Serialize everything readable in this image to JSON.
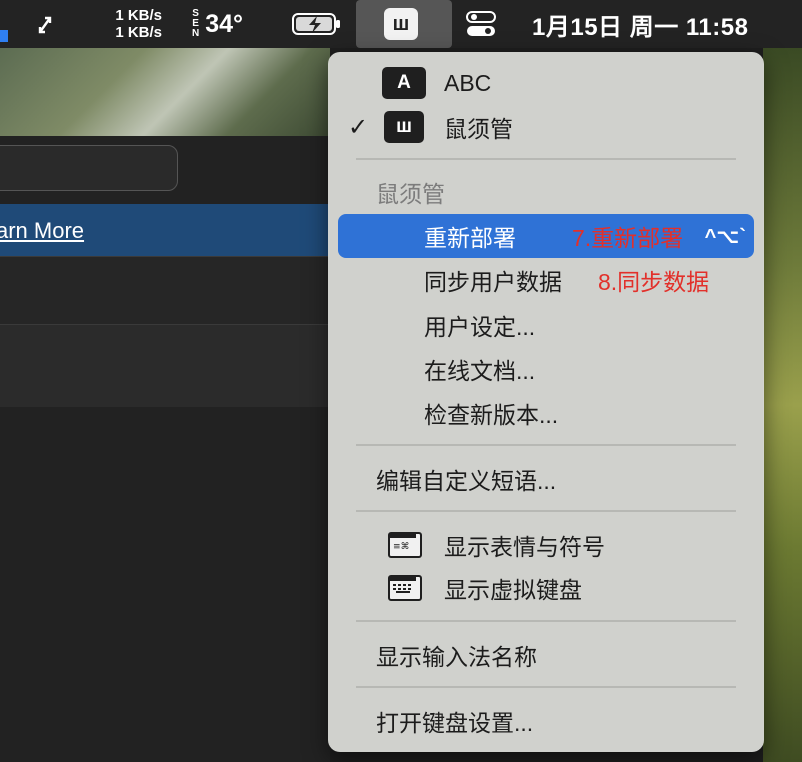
{
  "menubar": {
    "net_up": "1 KB/s",
    "net_down": "1 KB/s",
    "temp_letters": [
      "S",
      "E",
      "N"
    ],
    "temperature": "34°",
    "ime_glyph": "ш",
    "clock": "1月15日 周一  11:58",
    "icons": [
      "arrows-icon",
      "battery-icon",
      "ime-icon",
      "control-center-icon"
    ]
  },
  "background": {
    "learn_more": "arn More"
  },
  "menu": {
    "abc_badge": "A",
    "abc_label": "ABC",
    "ime_badge": "ш",
    "ime_label": "鼠须管",
    "section_title": "鼠须管",
    "items": [
      {
        "label": "重新部署",
        "annotation": "7.重新部署",
        "shortcut": "^⌥`"
      },
      {
        "label": "同步用户数据",
        "annotation": "8.同步数据"
      },
      {
        "label": "用户设定..."
      },
      {
        "label": "在线文档..."
      },
      {
        "label": "检查新版本..."
      }
    ],
    "edit_phrases": "编辑自定义短语...",
    "emoji": "显示表情与符号",
    "virtual_keyboard": "显示虚拟键盘",
    "show_ime_name": "显示输入法名称",
    "open_keyboard_settings": "打开键盘设置..."
  }
}
